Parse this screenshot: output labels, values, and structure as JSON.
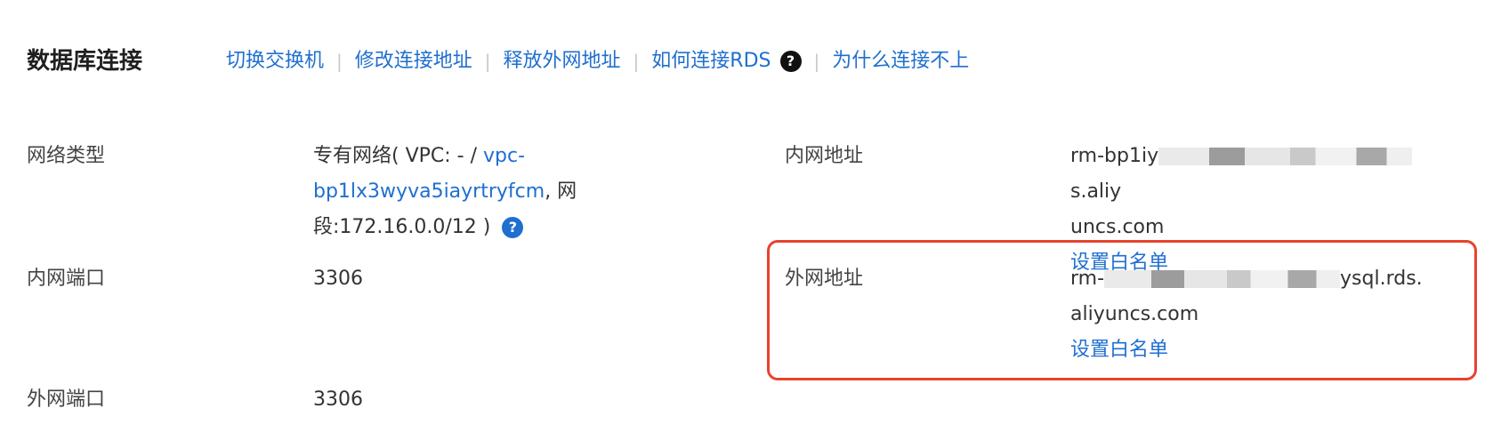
{
  "section": {
    "title": "数据库连接",
    "actions": [
      {
        "label": "切换交换机"
      },
      {
        "label": "修改连接地址"
      },
      {
        "label": "释放外网地址"
      },
      {
        "label": "如何连接RDS",
        "icon": "help-circle-icon"
      },
      {
        "label": "为什么连接不上"
      }
    ],
    "separator": "|"
  },
  "fields": {
    "network_type": {
      "label": "网络类型",
      "line1_prefix": "专有网络( VPC: - / ",
      "vpc_link_part1": "vpc-",
      "vpc_link_part2": "bp1lx3wyva5iayrtryfcm",
      "line2_suffix": ", 网",
      "line3": "段:172.16.0.0/12 )"
    },
    "internal_address": {
      "label": "内网地址",
      "line1_start": "rm-bp1iy",
      "line1_end": "s.aliy",
      "line2": "uncs.com",
      "whitelist_link": "设置白名单"
    },
    "internal_port": {
      "label": "内网端口",
      "value": "3306"
    },
    "external_address": {
      "label": "外网地址",
      "line1_start": "rm-",
      "line1_end": "ysql.rds.",
      "line2": "aliyuncs.com",
      "whitelist_link": "设置白名单"
    },
    "external_port": {
      "label": "外网端口",
      "value": "3306"
    }
  },
  "colors": {
    "link": "#1f6fcf",
    "highlight": "#e8422e"
  }
}
